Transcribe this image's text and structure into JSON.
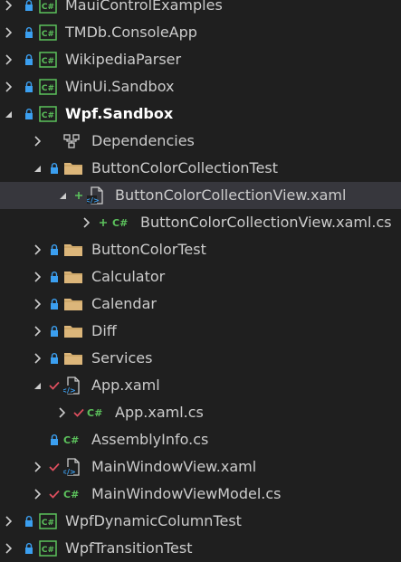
{
  "colors": {
    "background": "#1f1f1f",
    "selected_row": "#37373d",
    "text": "#cccccc",
    "lock": "#3b9ff0",
    "check": "#e04f5f",
    "plus": "#5cc25c",
    "csharp": "#5cc25c",
    "folder": "#dcb67a"
  },
  "tree": {
    "items": [
      {
        "label": "MauiControlExamples",
        "kind": "project",
        "status": "lock",
        "expander": "right"
      },
      {
        "label": "TMDb.ConsoleApp",
        "kind": "project",
        "status": "lock",
        "expander": "right"
      },
      {
        "label": "WikipediaParser",
        "kind": "project",
        "status": "lock",
        "expander": "right"
      },
      {
        "label": "WinUi.Sandbox",
        "kind": "project",
        "status": "lock",
        "expander": "right"
      },
      {
        "label": "Wpf.Sandbox",
        "kind": "project",
        "status": "lock",
        "expander": "down"
      },
      {
        "label": "Dependencies",
        "kind": "dependencies",
        "status": "",
        "expander": "right"
      },
      {
        "label": "ButtonColorCollectionTest",
        "kind": "folder",
        "status": "lock",
        "expander": "down"
      },
      {
        "label": "ButtonColorCollectionView.xaml",
        "kind": "xaml",
        "status": "plus",
        "expander": "down"
      },
      {
        "label": "ButtonColorCollectionView.xaml.cs",
        "kind": "csharp",
        "status": "plus",
        "expander": "right"
      },
      {
        "label": "ButtonColorTest",
        "kind": "folder",
        "status": "lock",
        "expander": "right"
      },
      {
        "label": "Calculator",
        "kind": "folder",
        "status": "lock",
        "expander": "right"
      },
      {
        "label": "Calendar",
        "kind": "folder",
        "status": "lock",
        "expander": "right"
      },
      {
        "label": "Diff",
        "kind": "folder",
        "status": "lock",
        "expander": "right"
      },
      {
        "label": "Services",
        "kind": "folder",
        "status": "lock",
        "expander": "right"
      },
      {
        "label": "App.xaml",
        "kind": "xaml",
        "status": "check",
        "expander": "down"
      },
      {
        "label": "App.xaml.cs",
        "kind": "csharp",
        "status": "check",
        "expander": "right"
      },
      {
        "label": "AssemblyInfo.cs",
        "kind": "csharp",
        "status": "lock",
        "expander": ""
      },
      {
        "label": "MainWindowView.xaml",
        "kind": "xaml",
        "status": "check",
        "expander": "right"
      },
      {
        "label": "MainWindowViewModel.cs",
        "kind": "csharp",
        "status": "check",
        "expander": "right"
      },
      {
        "label": "WpfDynamicColumnTest",
        "kind": "project",
        "status": "lock",
        "expander": "right"
      },
      {
        "label": "WpfTransitionTest",
        "kind": "project",
        "status": "lock",
        "expander": "right"
      }
    ]
  }
}
